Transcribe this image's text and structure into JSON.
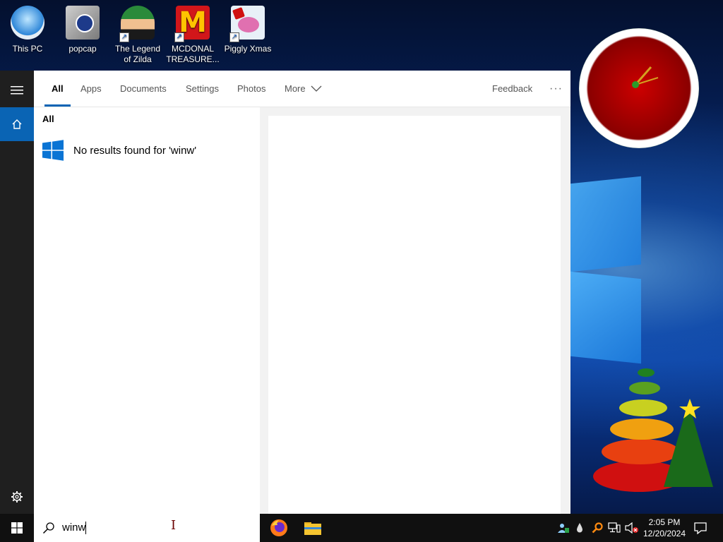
{
  "desktop": {
    "icons": [
      {
        "label": "This PC",
        "icon": "monitor-icon"
      },
      {
        "label": "popcap",
        "icon": "folder-icon"
      },
      {
        "label": "The Legend of Zilda",
        "icon": "game-icon"
      },
      {
        "label": "MCDONAL TREASURE...",
        "icon": "mcdonalds-icon"
      },
      {
        "label": "Piggly Xmas",
        "icon": "pig-icon"
      }
    ]
  },
  "start_menu": {
    "rail": {
      "menu_icon": "hamburger-icon",
      "home_icon": "home-icon",
      "settings_icon": "gear-icon"
    },
    "tabs": [
      {
        "label": "All",
        "active": true
      },
      {
        "label": "Apps"
      },
      {
        "label": "Documents"
      },
      {
        "label": "Settings"
      },
      {
        "label": "Photos"
      },
      {
        "label": "More"
      }
    ],
    "feedback_label": "Feedback",
    "overflow_label": "···",
    "results": {
      "section_label": "All",
      "message": "No results found for 'winw'"
    }
  },
  "taskbar": {
    "search_value": "winw",
    "apps": [
      "firefox-icon",
      "file-explorer-icon"
    ],
    "tray_icons": [
      "people-icon",
      "water-drop-icon",
      "search-orange-icon",
      "network-icon",
      "volume-muted-icon"
    ],
    "time": "2:05 PM",
    "date": "12/20/2024"
  },
  "colors": {
    "accent": "#0a64b4",
    "taskbar": "#101010",
    "rail": "#1f1f1f"
  }
}
